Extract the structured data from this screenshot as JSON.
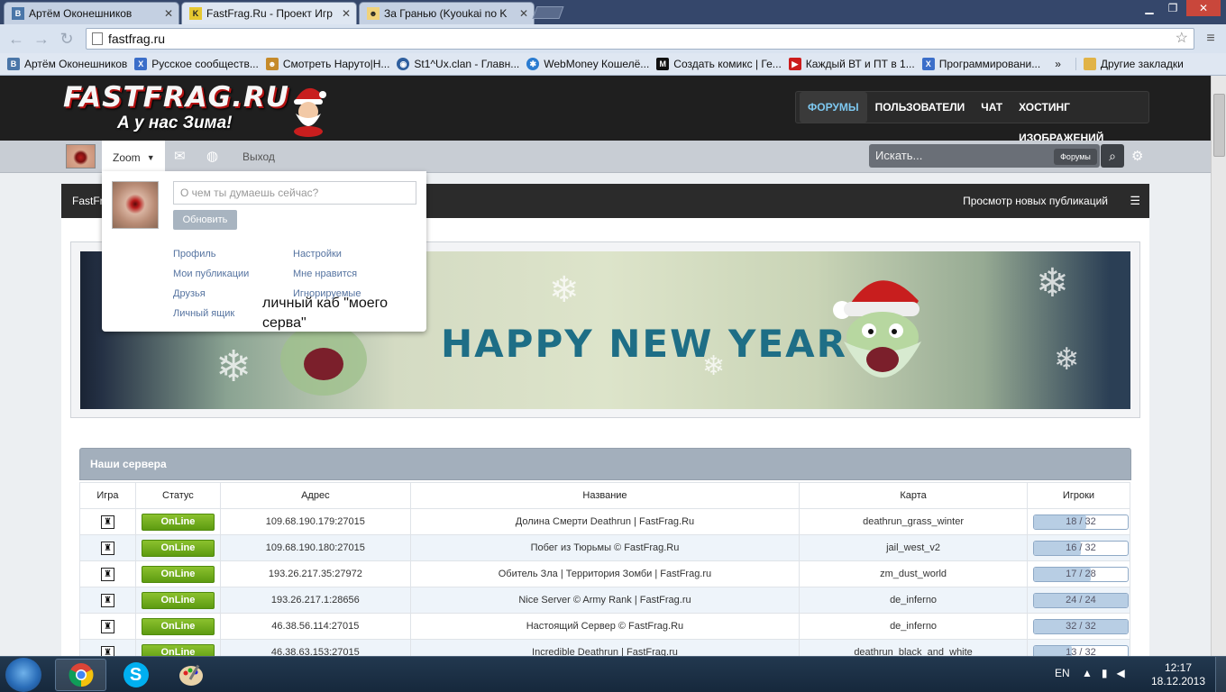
{
  "browser": {
    "tabs": [
      {
        "title": "Артём Оконешников",
        "icon": "vk-icon",
        "active": false
      },
      {
        "title": "FastFrag.Ru - Проект Игр",
        "icon": "fastfrag-icon",
        "active": true
      },
      {
        "title": "За Гранью (Kyoukai no K",
        "icon": "anime-icon",
        "active": false
      }
    ],
    "window_controls": [
      "minimize",
      "maximize",
      "close"
    ],
    "url": "fastfrag.ru",
    "bookmarks": [
      {
        "label": "Артём Оконешников",
        "icon": "vk-icon",
        "color": "#4a76a8"
      },
      {
        "label": "Русское сообществ...",
        "icon": "x-icon",
        "color": "#3b6ec9"
      },
      {
        "label": "Смотреть Наруто|Н...",
        "icon": "naruto-icon",
        "color": "#c58a2a"
      },
      {
        "label": "St1^Ux.clan - Главн...",
        "icon": "clan-icon",
        "color": "#2f5f9e"
      },
      {
        "label": "WebMoney Кошелё...",
        "icon": "webmoney-icon",
        "color": "#2a7bd0"
      },
      {
        "label": "Создать комикс | Ге...",
        "icon": "comic-icon",
        "color": "#111111"
      },
      {
        "label": "Каждый ВТ и ПТ в 1...",
        "icon": "youtube-icon",
        "color": "#cc1b1b"
      },
      {
        "label": "Программировани...",
        "icon": "x-icon",
        "color": "#3b6ec9"
      }
    ],
    "bookmarks_overflow": "»",
    "other_bookmarks": "Другие закладки"
  },
  "site": {
    "logo": "FASTFRAG.RU",
    "slogan": "А у нас Зима!",
    "nav": [
      "ФОРУМЫ",
      "ПОЛЬЗОВАТЕЛИ",
      "ЧАТ",
      "ХОСТИНГ ИЗОБРАЖЕНИЙ"
    ],
    "userbar": {
      "username": "Zoom",
      "logout": "Выход"
    },
    "search": {
      "placeholder": "Искать...",
      "scope": "Форумы"
    },
    "breadcrumb": {
      "left": "FastFr",
      "right": "Просмотр новых публикаций"
    },
    "banner_text": "HAPPY NEW YEAR"
  },
  "dropdown": {
    "status_placeholder": "О чем ты думаешь сейчас?",
    "update_button": "Обновить",
    "links_left": [
      "Профиль",
      "Мои публикации",
      "Друзья",
      "Личный ящик"
    ],
    "links_right": [
      "Настройки",
      "Мне нравится",
      "Игнорируемые"
    ]
  },
  "annotation": "личный каб \"моего серва\"",
  "servers": {
    "title": "Наши сервера",
    "columns": [
      "Игра",
      "Статус",
      "Адрес",
      "Название",
      "Карта",
      "Игроки"
    ],
    "rows": [
      {
        "status": "OnLine",
        "address": "109.68.190.179:27015",
        "name": "Долина Смерти Deathrun | FastFrag.Ru",
        "map": "deathrun_grass_winter",
        "players": "18 / 32",
        "fill": 0.5625
      },
      {
        "status": "OnLine",
        "address": "109.68.190.180:27015",
        "name": "Побег из Тюрьмы © FastFrag.Ru",
        "map": "jail_west_v2",
        "players": "16 / 32",
        "fill": 0.5
      },
      {
        "status": "OnLine",
        "address": "193.26.217.35:27972",
        "name": "Обитель Зла | Территория Зомби | FastFrag.ru",
        "map": "zm_dust_world",
        "players": "17 / 28",
        "fill": 0.607
      },
      {
        "status": "OnLine",
        "address": "193.26.217.1:28656",
        "name": "Nice Server © Army Rank | FastFrag.ru",
        "map": "de_inferno",
        "players": "24 / 24",
        "fill": 1.0
      },
      {
        "status": "OnLine",
        "address": "46.38.56.114:27015",
        "name": "Настоящий Сервер © FastFrag.Ru",
        "map": "de_inferno",
        "players": "32 / 32",
        "fill": 1.0
      },
      {
        "status": "OnLine",
        "address": "46.38.63.153:27015",
        "name": "Incredible Deathrun | FastFrag.ru",
        "map": "deathrun_black_and_white",
        "players": "13 / 32",
        "fill": 0.406
      }
    ]
  },
  "taskbar": {
    "apps": [
      "chrome-icon",
      "skype-icon",
      "paint-icon"
    ],
    "skype_letter": "S",
    "language": "EN",
    "time": "12:17",
    "date": "18.12.2013"
  }
}
